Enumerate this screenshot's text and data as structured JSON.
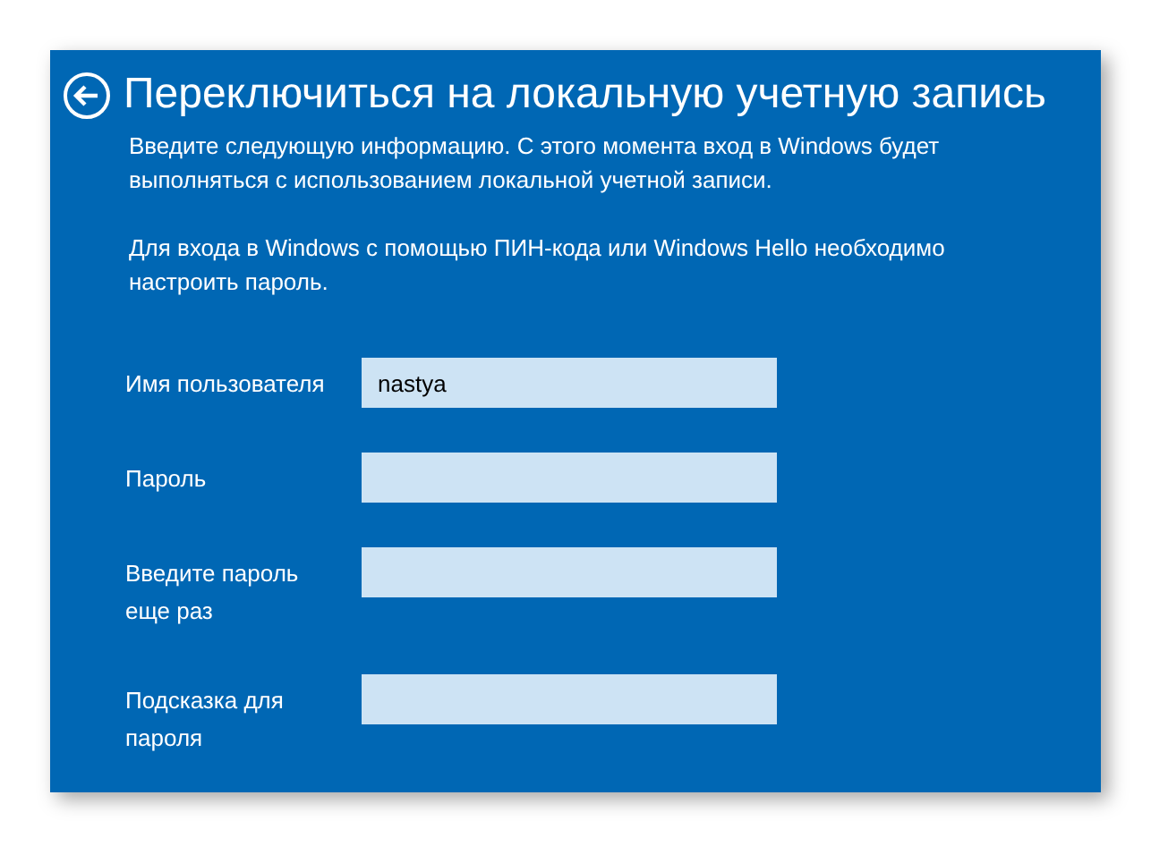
{
  "window": {
    "title": "Переключиться на локальную учетную запись"
  },
  "paragraphs": [
    "Введите следующую информацию. С этого момента вход в Windows будет выполняться с использованием локальной учетной записи.",
    "Для входа в Windows с помощью ПИН-кода или Windows Hello необходимо настроить пароль."
  ],
  "fields": [
    {
      "label": "Имя пользователя",
      "value": "nastya"
    },
    {
      "label": "Пароль"
    },
    {
      "label": "Введите пароль еще раз"
    },
    {
      "label": "Подсказка для пароля"
    }
  ]
}
